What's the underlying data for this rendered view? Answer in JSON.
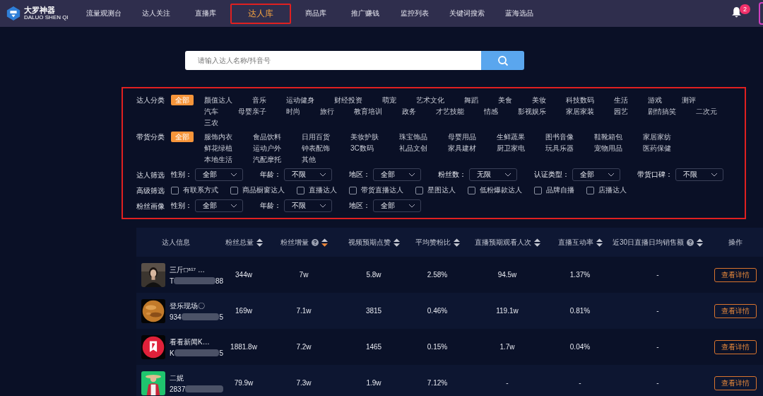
{
  "brand": {
    "name": "大罗神器",
    "subtitle": "DALUO SHEN QI"
  },
  "nav": [
    {
      "label": "流量观测台",
      "selected": false,
      "highlighted": false
    },
    {
      "label": "达人关注",
      "selected": false,
      "highlighted": false
    },
    {
      "label": "直播库",
      "selected": false,
      "highlighted": false
    },
    {
      "label": "达人库",
      "selected": true,
      "highlighted": true
    },
    {
      "label": "商品库",
      "selected": false,
      "highlighted": false
    },
    {
      "label": "推广赚钱",
      "selected": false,
      "highlighted": false
    },
    {
      "label": "监控列表",
      "selected": false,
      "highlighted": false
    },
    {
      "label": "关键词搜索",
      "selected": false,
      "highlighted": false
    },
    {
      "label": "蓝海选品",
      "selected": false,
      "highlighted": false
    }
  ],
  "notifications": {
    "count": "2"
  },
  "search": {
    "placeholder": "请输入达人名称/抖音号"
  },
  "filters": {
    "highlighted": true,
    "rows": [
      {
        "kind": "options",
        "label": "达人分类",
        "all": {
          "label": "全部",
          "selected": true
        },
        "options": [
          {
            "label": "颜值达人",
            "selected": false
          },
          {
            "label": "音乐",
            "selected": false
          },
          {
            "label": "运动健身",
            "selected": false
          },
          {
            "label": "财经投资",
            "selected": false
          },
          {
            "label": "萌宠",
            "selected": false
          },
          {
            "label": "艺术文化",
            "selected": false
          },
          {
            "label": "舞蹈",
            "selected": false
          },
          {
            "label": "美食",
            "selected": false
          },
          {
            "label": "美妆",
            "selected": false
          },
          {
            "label": "科技数码",
            "selected": false
          },
          {
            "label": "生活",
            "selected": false
          },
          {
            "label": "游戏",
            "selected": false
          },
          {
            "label": "测评",
            "selected": false
          },
          {
            "label": "汽车",
            "selected": false
          },
          {
            "label": "母婴亲子",
            "selected": false
          },
          {
            "label": "时尚",
            "selected": false
          },
          {
            "label": "旅行",
            "selected": false
          },
          {
            "label": "教育培训",
            "selected": false
          },
          {
            "label": "政务",
            "selected": false
          },
          {
            "label": "才艺技能",
            "selected": false
          },
          {
            "label": "情感",
            "selected": false
          },
          {
            "label": "影视娱乐",
            "selected": false
          },
          {
            "label": "家居家装",
            "selected": false
          },
          {
            "label": "园艺",
            "selected": false
          },
          {
            "label": "剧情搞笑",
            "selected": false
          },
          {
            "label": "二次元",
            "selected": false
          },
          {
            "label": "三农",
            "selected": false
          }
        ]
      },
      {
        "kind": "options",
        "label": "带货分类",
        "all": {
          "label": "全部",
          "selected": true
        },
        "options": [
          {
            "label": "服饰内衣",
            "selected": false
          },
          {
            "label": "食品饮料",
            "selected": false
          },
          {
            "label": "日用百货",
            "selected": false
          },
          {
            "label": "美妆护肤",
            "selected": false
          },
          {
            "label": "珠宝饰品",
            "selected": false
          },
          {
            "label": "母婴用品",
            "selected": false
          },
          {
            "label": "生鲜蔬果",
            "selected": false
          },
          {
            "label": "图书音像",
            "selected": false
          },
          {
            "label": "鞋靴箱包",
            "selected": false
          },
          {
            "label": "家居家纺",
            "selected": false
          },
          {
            "label": "鲜花绿植",
            "selected": false
          },
          {
            "label": "运动户外",
            "selected": false
          },
          {
            "label": "钟表配饰",
            "selected": false
          },
          {
            "label": "3C数码",
            "selected": false
          },
          {
            "label": "礼品文创",
            "selected": false
          },
          {
            "label": "家具建材",
            "selected": false
          },
          {
            "label": "厨卫家电",
            "selected": false
          },
          {
            "label": "玩具乐器",
            "selected": false
          },
          {
            "label": "宠物用品",
            "selected": false
          },
          {
            "label": "医药保健",
            "selected": false
          },
          {
            "label": "本地生活",
            "selected": false
          },
          {
            "label": "汽配摩托",
            "selected": false
          },
          {
            "label": "其他",
            "selected": false
          }
        ]
      },
      {
        "kind": "selects",
        "label": "达人筛选",
        "selects": [
          {
            "label": "性别：",
            "value": "全部"
          },
          {
            "label": "年龄：",
            "value": "不限"
          },
          {
            "label": "地区：",
            "value": "全部"
          },
          {
            "label": "粉丝数：",
            "value": "无限"
          },
          {
            "label": "认证类型：",
            "value": "全部"
          },
          {
            "label": "带货口碑：",
            "value": "不限"
          }
        ]
      },
      {
        "kind": "checkboxes",
        "label": "高级筛选",
        "checkboxes": [
          {
            "label": "有联系方式",
            "checked": false
          },
          {
            "label": "商品橱窗达人",
            "checked": false
          },
          {
            "label": "直播达人",
            "checked": false
          },
          {
            "label": "带货直播达人",
            "checked": false
          },
          {
            "label": "星图达人",
            "checked": false
          },
          {
            "label": "低粉爆款达人",
            "checked": false
          },
          {
            "label": "品牌自播",
            "checked": false
          },
          {
            "label": "店播达人",
            "checked": false
          }
        ]
      },
      {
        "kind": "selects",
        "label": "粉丝画像",
        "selects": [
          {
            "label": "性别：",
            "value": "全部"
          },
          {
            "label": "年龄：",
            "value": "不限"
          },
          {
            "label": "地区：",
            "value": "全部"
          }
        ]
      }
    ]
  },
  "table": {
    "columns": [
      {
        "label": "达人信息",
        "sortable": false,
        "sorted_desc": false,
        "help": false
      },
      {
        "label": "粉丝总量",
        "sortable": true,
        "sorted_desc": false,
        "help": false
      },
      {
        "label": "粉丝增量",
        "sortable": true,
        "sorted_desc": true,
        "help": true
      },
      {
        "label": "视频预期点赞",
        "sortable": true,
        "sorted_desc": false,
        "help": false
      },
      {
        "label": "平均赞粉比",
        "sortable": true,
        "sorted_desc": false,
        "help": false
      },
      {
        "label": "直播预期观看人次",
        "sortable": true,
        "sorted_desc": false,
        "help": false
      },
      {
        "label": "直播互动率",
        "sortable": true,
        "sorted_desc": false,
        "help": false
      },
      {
        "label": "近30日直播日均销售额",
        "sortable": true,
        "sorted_desc": false,
        "help": true
      },
      {
        "label": "操作",
        "sortable": false,
        "sorted_desc": false,
        "help": false
      }
    ],
    "rows": [
      {
        "name": "三斤□⁸¹⁷ …",
        "id_start": "T",
        "id_end": "88",
        "metrics": [
          "344w",
          "7w",
          "5.8w",
          "2.58%",
          "94.5w",
          "1.37%",
          "-"
        ],
        "action": "查看详情"
      },
      {
        "name": "登乐现场〇",
        "id_start": "934",
        "id_end": "5",
        "metrics": [
          "169w",
          "7.1w",
          "3815",
          "0.46%",
          "119.1w",
          "0.81%",
          "-"
        ],
        "action": "查看详情"
      },
      {
        "name": "看看新闻K…",
        "id_start": "K",
        "id_end": "5",
        "metrics": [
          "1881.8w",
          "7.2w",
          "1465",
          "0.15%",
          "1.7w",
          "0.04%",
          "-"
        ],
        "action": "查看详情"
      },
      {
        "name": "二妮",
        "id_start": "2837",
        "metrics": [
          "79.9w",
          "7.3w",
          "1.9w",
          "7.12%",
          "-",
          "-",
          "-"
        ],
        "action": "查看详情"
      }
    ]
  }
}
